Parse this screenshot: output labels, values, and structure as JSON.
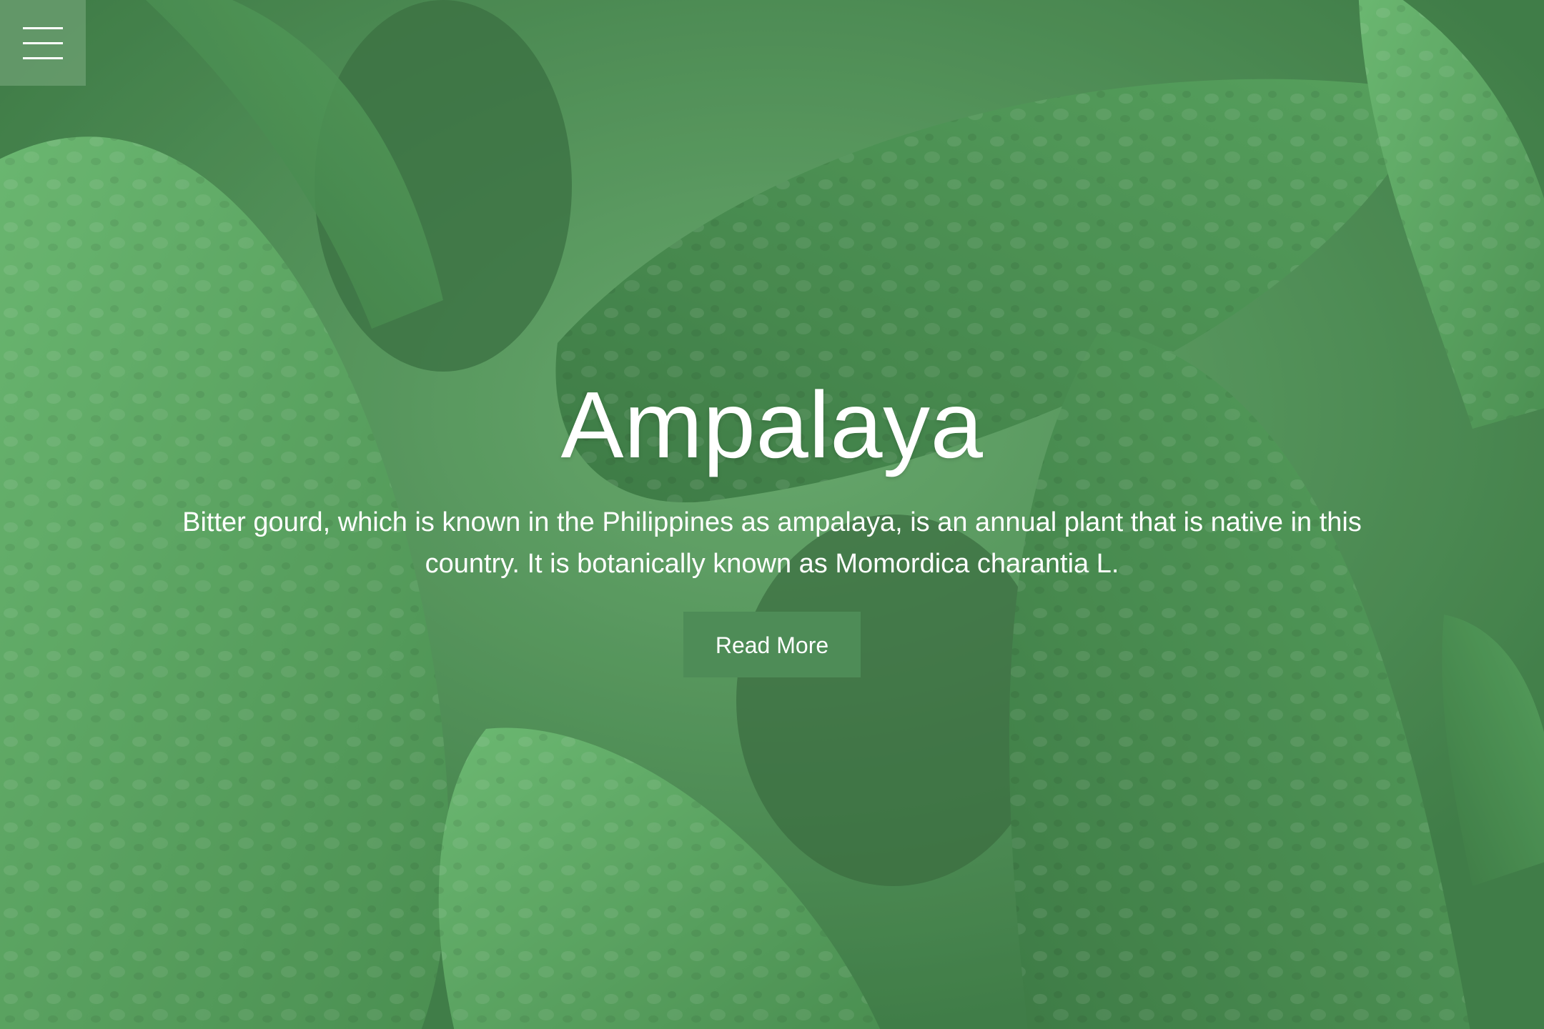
{
  "nav": {
    "menu_icon": "hamburger-menu-icon"
  },
  "hero": {
    "title": "Ampalaya",
    "description": "Bitter gourd, which is known in the Philippines as ampalaya, is an annual plant that is native in this country. It is botanically known as Momordica charantia L.",
    "button_label": "Read More"
  },
  "colors": {
    "background_green": "#4f8f58",
    "button_green": "#4e8c57",
    "text_white": "#ffffff"
  }
}
